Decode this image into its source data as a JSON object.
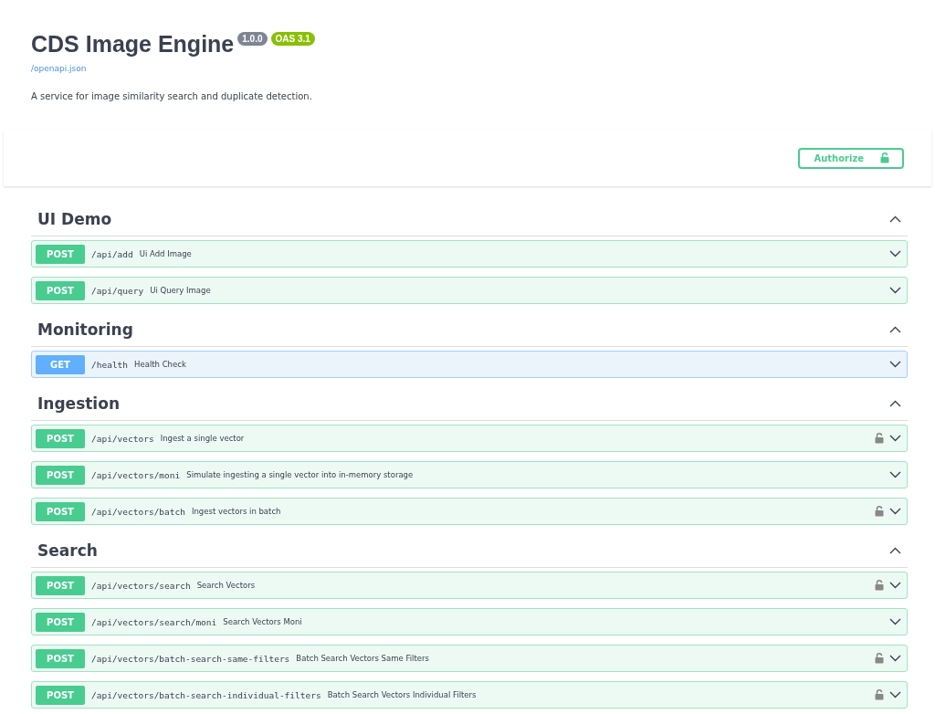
{
  "info": {
    "title": "CDS Image Engine",
    "version": "1.0.0",
    "oas": "OAS 3.1",
    "spec_link": "/openapi.json",
    "description": "A service for image similarity search and duplicate detection."
  },
  "authorize": {
    "label": "Authorize"
  },
  "sections": [
    {
      "name": "UI Demo",
      "expanded": true,
      "operations": [
        {
          "method": "POST",
          "path": "/api/add",
          "summary": "Ui Add Image",
          "locked": false
        },
        {
          "method": "POST",
          "path": "/api/query",
          "summary": "Ui Query Image",
          "locked": false
        }
      ]
    },
    {
      "name": "Monitoring",
      "expanded": true,
      "operations": [
        {
          "method": "GET",
          "path": "/health",
          "summary": "Health Check",
          "locked": false
        }
      ]
    },
    {
      "name": "Ingestion",
      "expanded": true,
      "operations": [
        {
          "method": "POST",
          "path": "/api/vectors",
          "summary": "Ingest a single vector",
          "locked": true
        },
        {
          "method": "POST",
          "path": "/api/vectors/moni",
          "summary": "Simulate ingesting a single vector into in-memory storage",
          "locked": false
        },
        {
          "method": "POST",
          "path": "/api/vectors/batch",
          "summary": "Ingest vectors in batch",
          "locked": true
        }
      ]
    },
    {
      "name": "Search",
      "expanded": true,
      "operations": [
        {
          "method": "POST",
          "path": "/api/vectors/search",
          "summary": "Search Vectors",
          "locked": true
        },
        {
          "method": "POST",
          "path": "/api/vectors/search/moni",
          "summary": "Search Vectors Moni",
          "locked": false
        },
        {
          "method": "POST",
          "path": "/api/vectors/batch-search-same-filters",
          "summary": "Batch Search Vectors Same Filters",
          "locked": true
        },
        {
          "method": "POST",
          "path": "/api/vectors/batch-search-individual-filters",
          "summary": "Batch Search Vectors Individual Filters",
          "locked": true
        }
      ]
    }
  ]
}
